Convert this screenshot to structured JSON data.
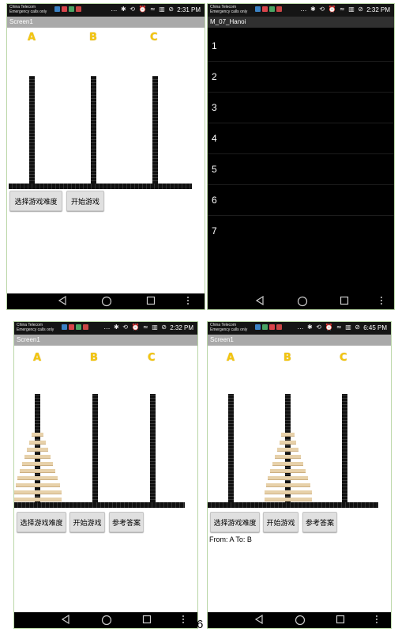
{
  "panels": [
    {
      "carrier": [
        "China Telecom",
        "Emergency calls only"
      ],
      "time": "2:31 PM",
      "title": "Screen1"
    },
    {
      "carrier": [
        "China Telecom",
        "Emergency calls only"
      ],
      "time": "2:32 PM",
      "title": "M_07_Hanoi"
    },
    {
      "carrier": [
        "China Telecom",
        "Emergency calls only"
      ],
      "time": "2:32 PM",
      "title": "Screen1"
    },
    {
      "carrier": [
        "China Telecom",
        "Emergency calls only"
      ],
      "time": "6:45 PM",
      "title": "Screen1"
    }
  ],
  "pegs": [
    "A",
    "B",
    "C"
  ],
  "buttons": {
    "difficulty": "选择游戏难度",
    "start": "开始游戏",
    "answer": "参考答案"
  },
  "difficulty_list": [
    "1",
    "2",
    "3",
    "4",
    "5",
    "6",
    "7"
  ],
  "move_text": "From:  A To:  B",
  "page_number": "6",
  "colors": {
    "accent": "#f2c511",
    "disc": "#e7d1aa",
    "titlebar": "#a9a9a9"
  }
}
